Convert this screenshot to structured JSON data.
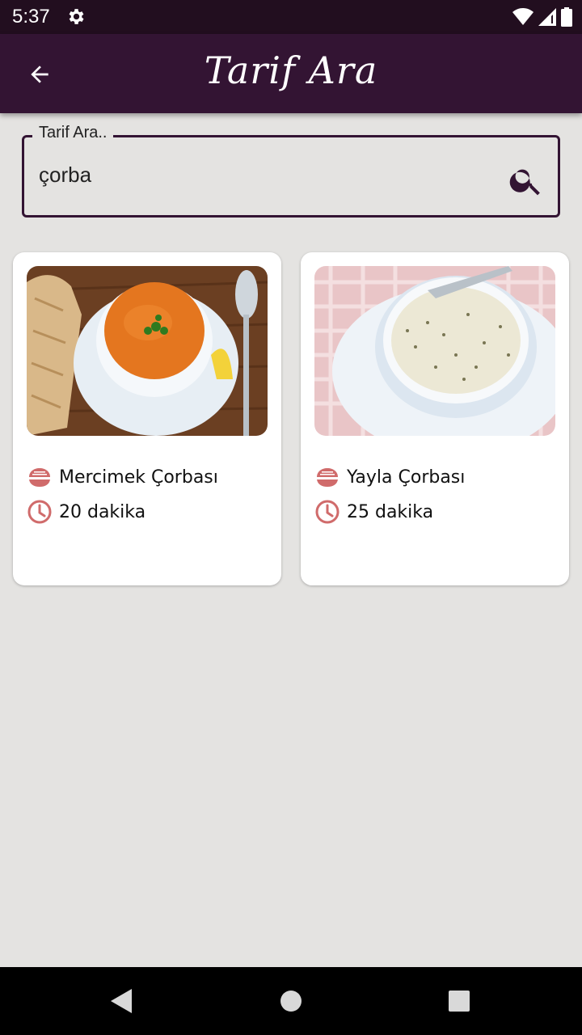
{
  "status": {
    "time": "5:37"
  },
  "app_bar": {
    "title": "Tarif Ara"
  },
  "search": {
    "label": "Tarif Ara..",
    "value": "çorba"
  },
  "recipes": [
    {
      "name": "Mercimek Çorbası",
      "duration": "20 dakika"
    },
    {
      "name": "Yayla Çorbası",
      "duration": "25 dakika"
    }
  ],
  "colors": {
    "primary": "#331433",
    "status_bar": "#220e1f",
    "background": "#e4e3e1",
    "icon_accent": "#d06b6b"
  }
}
